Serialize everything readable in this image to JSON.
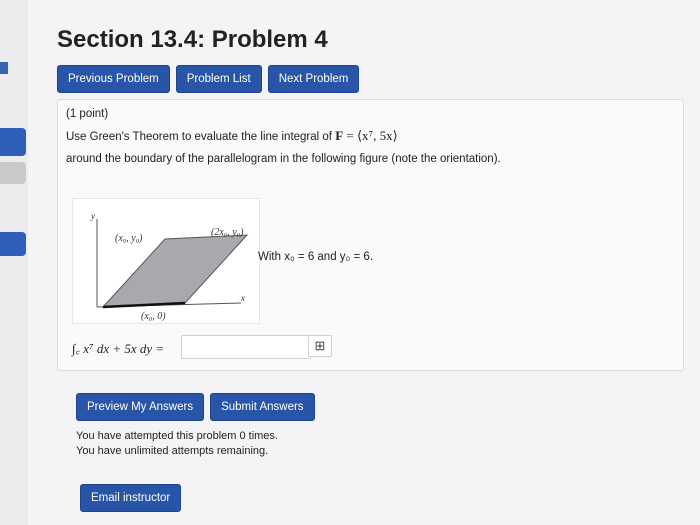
{
  "page": {
    "title": "Section 13.4: Problem 4"
  },
  "nav": {
    "previous": "Previous Problem",
    "list": "Problem List",
    "next": "Next Problem"
  },
  "problem": {
    "points": "(1 point)",
    "intro": "Use Green's Theorem to evaluate the line integral of ",
    "field_bold": "F",
    "field_rest": " = ⟨x⁷, 5x⟩",
    "line2": "around the boundary of the parallelogram in the following figure (note the orientation).",
    "with_text": "With x₀ = 6 and y₀ = 6.",
    "figure": {
      "axis_y": "y",
      "axis_x": "x",
      "label_top_left": "(x₀, y₀)",
      "label_top_right": "(2x₀, y₀)",
      "label_bottom": "(x₀, 0)"
    },
    "integral_text": "∫꜀ x⁷ dx + 5x dy =",
    "answer_value": "",
    "grid_icon": "⊞"
  },
  "actions": {
    "preview": "Preview My Answers",
    "submit": "Submit Answers"
  },
  "status": {
    "attempts": "You have attempted this problem 0 times.",
    "remaining": "You have unlimited attempts remaining."
  },
  "footer": {
    "email": "Email instructor"
  },
  "colors": {
    "button": "#2955a8",
    "parallelogram": "#a9a9ad"
  }
}
